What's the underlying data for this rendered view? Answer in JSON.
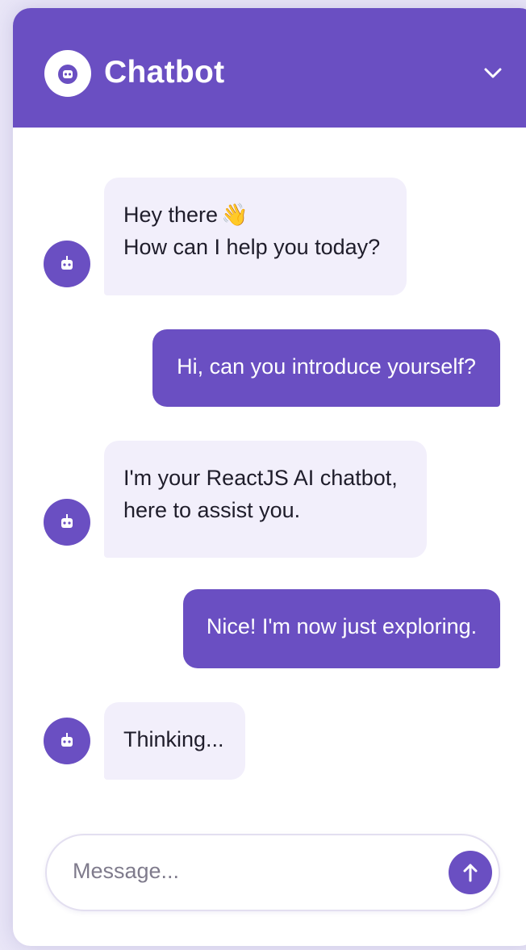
{
  "header": {
    "title": "Chatbot",
    "logo_icon": "chatbot-logo-icon",
    "collapse_icon": "chevron-down-icon"
  },
  "messages": [
    {
      "role": "bot",
      "lines": [
        "Hey there",
        "How can I help you today?"
      ],
      "emoji": "👋"
    },
    {
      "role": "user",
      "text": "Hi, can you introduce yourself?"
    },
    {
      "role": "bot",
      "lines": [
        "I'm your ReactJS AI chatbot,",
        "here to assist you."
      ]
    },
    {
      "role": "user",
      "text": "Nice! I'm now just exploring."
    },
    {
      "role": "bot",
      "lines": [
        "Thinking..."
      ]
    }
  ],
  "composer": {
    "placeholder": "Message...",
    "send_icon": "arrow-up-icon"
  },
  "colors": {
    "accent": "#6a4fc2",
    "bot_bubble": "#f2effb",
    "page_background": "#e9e6f7"
  }
}
